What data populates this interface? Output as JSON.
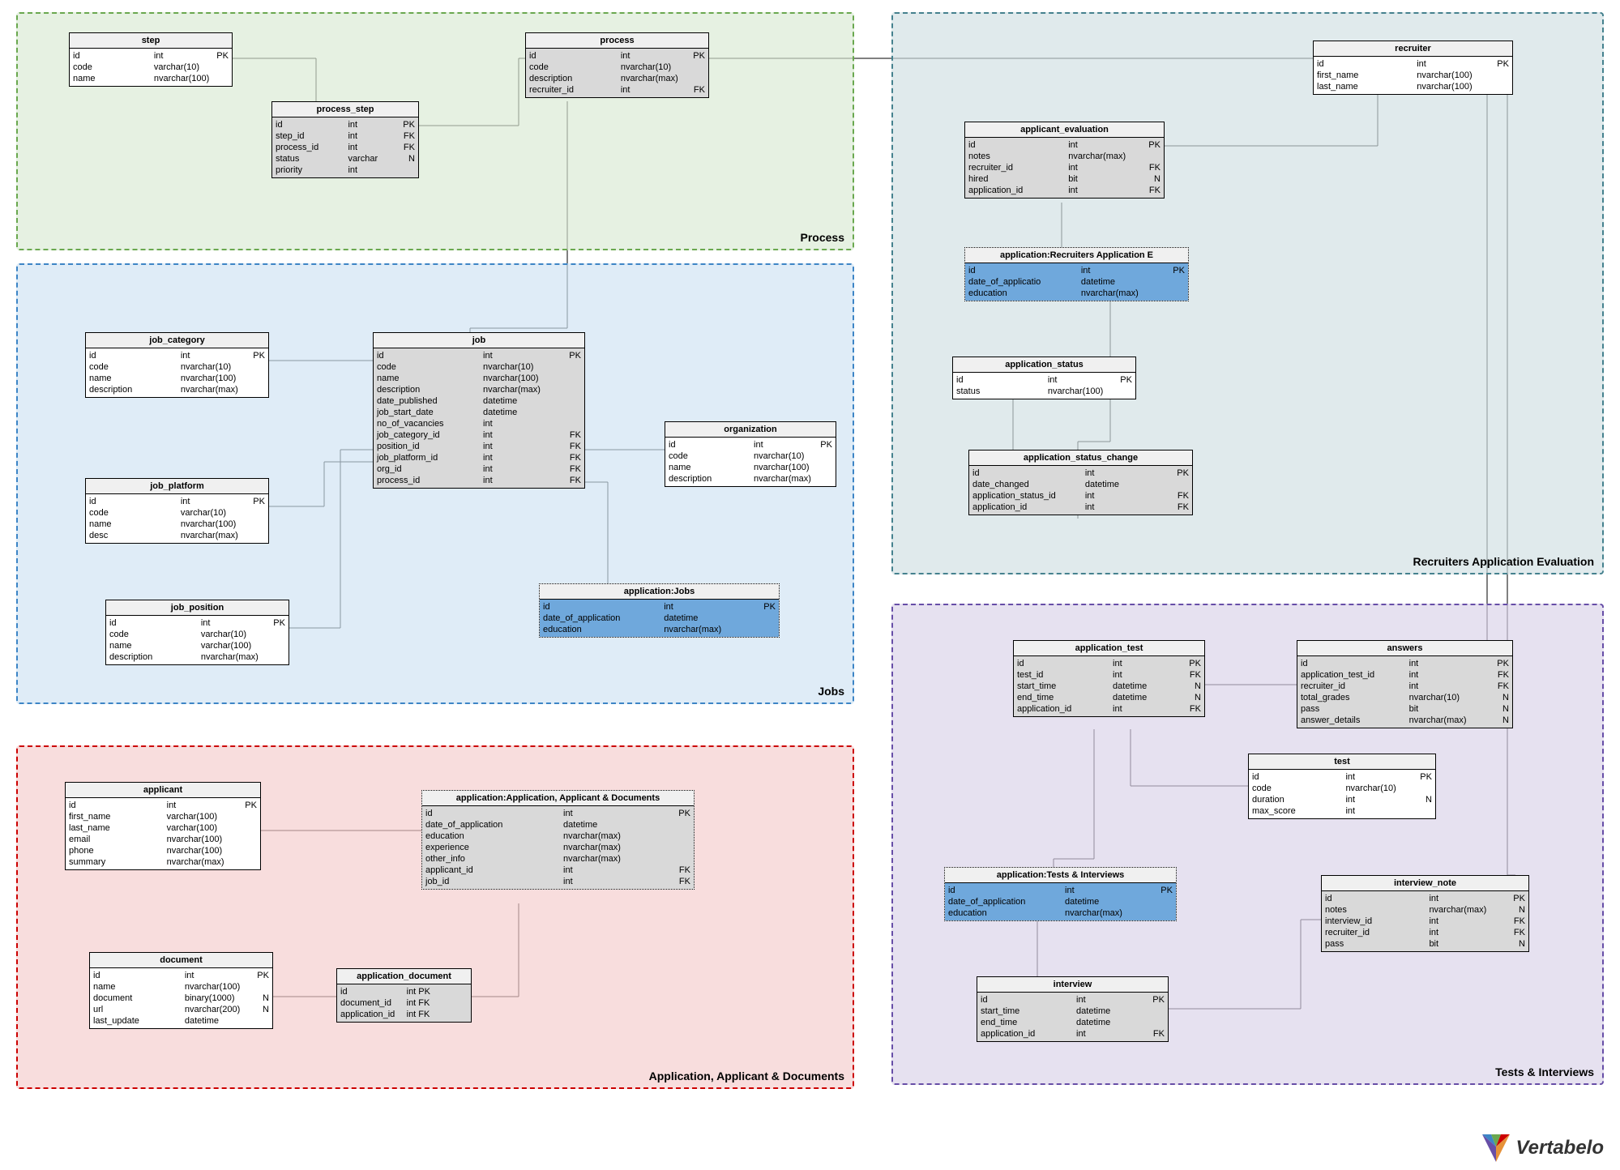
{
  "zones": {
    "process": {
      "label": "Process",
      "color": "#d9ead3"
    },
    "jobs": {
      "label": "Jobs",
      "color": "#cfe2f3"
    },
    "app": {
      "label": "Application, Applicant & Documents",
      "color": "#f4cccc"
    },
    "recr": {
      "label": "Recruiters Application Evaluation",
      "color": "#d0e0e3"
    },
    "tests": {
      "label": "Tests & Interviews",
      "color": "#d9d2e9"
    }
  },
  "logo": "Vertabelo",
  "entities": {
    "step": {
      "title": "step",
      "rows": [
        [
          "id",
          "int",
          "PK"
        ],
        [
          "code",
          "varchar(10)",
          ""
        ],
        [
          "name",
          "nvarchar(100)",
          ""
        ]
      ]
    },
    "process_step": {
      "title": "process_step",
      "rows": [
        [
          "id",
          "int",
          "PK"
        ],
        [
          "step_id",
          "int",
          "FK"
        ],
        [
          "process_id",
          "int",
          "FK"
        ],
        [
          "status",
          "varchar",
          "N"
        ],
        [
          "priority",
          "int",
          ""
        ]
      ]
    },
    "process": {
      "title": "process",
      "rows": [
        [
          "id",
          "int",
          "PK"
        ],
        [
          "code",
          "nvarchar(10)",
          ""
        ],
        [
          "description",
          "nvarchar(max)",
          ""
        ],
        [
          "recruiter_id",
          "int",
          "FK"
        ]
      ]
    },
    "job_category": {
      "title": "job_category",
      "rows": [
        [
          "id",
          "int",
          "PK"
        ],
        [
          "code",
          "nvarchar(10)",
          ""
        ],
        [
          "name",
          "nvarchar(100)",
          ""
        ],
        [
          "description",
          "nvarchar(max)",
          ""
        ]
      ]
    },
    "job_platform": {
      "title": "job_platform",
      "rows": [
        [
          "id",
          "int",
          "PK"
        ],
        [
          "code",
          "varchar(10)",
          ""
        ],
        [
          "name",
          "nvarchar(100)",
          ""
        ],
        [
          "desc",
          "nvarchar(max)",
          ""
        ]
      ]
    },
    "job_position": {
      "title": "job_position",
      "rows": [
        [
          "id",
          "int",
          "PK"
        ],
        [
          "code",
          "varchar(10)",
          ""
        ],
        [
          "name",
          "varchar(100)",
          ""
        ],
        [
          "description",
          "nvarchar(max)",
          ""
        ]
      ]
    },
    "job": {
      "title": "job",
      "rows": [
        [
          "id",
          "int",
          "PK"
        ],
        [
          "code",
          "nvarchar(10)",
          ""
        ],
        [
          "name",
          "nvarchar(100)",
          ""
        ],
        [
          "description",
          "nvarchar(max)",
          ""
        ],
        [
          "date_published",
          "datetime",
          ""
        ],
        [
          "job_start_date",
          "datetime",
          ""
        ],
        [
          "no_of_vacancies",
          "int",
          ""
        ],
        [
          "job_category_id",
          "int",
          "FK"
        ],
        [
          "position_id",
          "int",
          "FK"
        ],
        [
          "job_platform_id",
          "int",
          "FK"
        ],
        [
          "org_id",
          "int",
          "FK"
        ],
        [
          "process_id",
          "int",
          "FK"
        ]
      ]
    },
    "organization": {
      "title": "organization",
      "rows": [
        [
          "id",
          "int",
          "PK"
        ],
        [
          "code",
          "nvarchar(10)",
          ""
        ],
        [
          "name",
          "nvarchar(100)",
          ""
        ],
        [
          "description",
          "nvarchar(max)",
          ""
        ]
      ]
    },
    "application_jobs": {
      "title": "application:Jobs",
      "rows": [
        [
          "id",
          "int",
          "PK"
        ],
        [
          "date_of_application",
          "datetime",
          ""
        ],
        [
          "education",
          "nvarchar(max)",
          ""
        ]
      ]
    },
    "applicant": {
      "title": "applicant",
      "rows": [
        [
          "id",
          "int",
          "PK"
        ],
        [
          "first_name",
          "varchar(100)",
          ""
        ],
        [
          "last_name",
          "varchar(100)",
          ""
        ],
        [
          "email",
          "nvarchar(100)",
          ""
        ],
        [
          "phone",
          "nvarchar(100)",
          ""
        ],
        [
          "summary",
          "nvarchar(max)",
          ""
        ]
      ]
    },
    "application_app": {
      "title": "application:Application, Applicant & Documents",
      "rows": [
        [
          "id",
          "int",
          "PK"
        ],
        [
          "date_of_application",
          "datetime",
          ""
        ],
        [
          "education",
          "nvarchar(max)",
          ""
        ],
        [
          "experience",
          "nvarchar(max)",
          ""
        ],
        [
          "other_info",
          "nvarchar(max)",
          ""
        ],
        [
          "applicant_id",
          "int",
          "FK"
        ],
        [
          "job_id",
          "int",
          "FK"
        ]
      ]
    },
    "document": {
      "title": "document",
      "rows": [
        [
          "id",
          "int",
          "PK"
        ],
        [
          "name",
          "nvarchar(100)",
          ""
        ],
        [
          "document",
          "binary(1000)",
          "N"
        ],
        [
          "url",
          "nvarchar(200)",
          "N"
        ],
        [
          "last_update",
          "datetime",
          ""
        ]
      ]
    },
    "application_document": {
      "title": "application_document",
      "rows": [
        [
          "id",
          "int PK",
          ""
        ],
        [
          "document_id",
          "int FK",
          ""
        ],
        [
          "application_id",
          "int FK",
          ""
        ]
      ]
    },
    "recruiter": {
      "title": "recruiter",
      "rows": [
        [
          "id",
          "int",
          "PK"
        ],
        [
          "first_name",
          "nvarchar(100)",
          ""
        ],
        [
          "last_name",
          "nvarchar(100)",
          ""
        ]
      ]
    },
    "applicant_evaluation": {
      "title": "applicant_evaluation",
      "rows": [
        [
          "id",
          "int",
          "PK"
        ],
        [
          "notes",
          "nvarchar(max)",
          ""
        ],
        [
          "recruiter_id",
          "int",
          "FK"
        ],
        [
          "hired",
          "bit",
          "N"
        ],
        [
          "application_id",
          "int",
          "FK"
        ]
      ]
    },
    "application_recr": {
      "title": "application:Recruiters Application E",
      "rows": [
        [
          "id",
          "int",
          "PK"
        ],
        [
          "date_of_applicatio",
          "datetime",
          ""
        ],
        [
          "education",
          "nvarchar(max)",
          ""
        ]
      ]
    },
    "application_status": {
      "title": "application_status",
      "rows": [
        [
          "id",
          "int",
          "PK"
        ],
        [
          "status",
          "nvarchar(100)",
          ""
        ]
      ]
    },
    "application_status_change": {
      "title": "application_status_change",
      "rows": [
        [
          "id",
          "int",
          "PK"
        ],
        [
          "date_changed",
          "datetime",
          ""
        ],
        [
          "application_status_id",
          "int",
          "FK"
        ],
        [
          "application_id",
          "int",
          "FK"
        ]
      ]
    },
    "application_test": {
      "title": "application_test",
      "rows": [
        [
          "id",
          "int",
          "PK"
        ],
        [
          "test_id",
          "int",
          "FK"
        ],
        [
          "start_time",
          "datetime",
          "N"
        ],
        [
          "end_time",
          "datetime",
          "N"
        ],
        [
          "application_id",
          "int",
          "FK"
        ]
      ]
    },
    "answers": {
      "title": "answers",
      "rows": [
        [
          "id",
          "int",
          "PK"
        ],
        [
          "application_test_id",
          "int",
          "FK"
        ],
        [
          "recruiter_id",
          "int",
          "FK"
        ],
        [
          "total_grades",
          "nvarchar(10)",
          "N"
        ],
        [
          "pass",
          "bit",
          "N"
        ],
        [
          "answer_details",
          "nvarchar(max)",
          "N"
        ]
      ]
    },
    "test": {
      "title": "test",
      "rows": [
        [
          "id",
          "int",
          "PK"
        ],
        [
          "code",
          "nvarchar(10)",
          ""
        ],
        [
          "duration",
          "int",
          "N"
        ],
        [
          "max_score",
          "int",
          ""
        ]
      ]
    },
    "application_tests": {
      "title": "application:Tests & Interviews",
      "rows": [
        [
          "id",
          "int",
          "PK"
        ],
        [
          "date_of_application",
          "datetime",
          ""
        ],
        [
          "education",
          "nvarchar(max)",
          ""
        ]
      ]
    },
    "interview": {
      "title": "interview",
      "rows": [
        [
          "id",
          "int",
          "PK"
        ],
        [
          "start_time",
          "datetime",
          ""
        ],
        [
          "end_time",
          "datetime",
          ""
        ],
        [
          "application_id",
          "int",
          "FK"
        ]
      ]
    },
    "interview_note": {
      "title": "interview_note",
      "rows": [
        [
          "id",
          "int",
          "PK"
        ],
        [
          "notes",
          "nvarchar(max)",
          "N"
        ],
        [
          "interview_id",
          "int",
          "FK"
        ],
        [
          "recruiter_id",
          "int",
          "FK"
        ],
        [
          "pass",
          "bit",
          "N"
        ]
      ]
    }
  }
}
